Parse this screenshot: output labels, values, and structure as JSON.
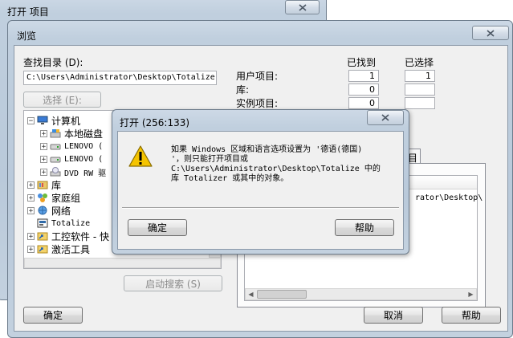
{
  "outer_window": {
    "title": "打开 项目"
  },
  "browse_dialog": {
    "title": "浏览",
    "lookin_label": "查找目录 (D):",
    "path_value": "C:\\Users\\Administrator\\Desktop\\Totalize",
    "select_button": "选择 (E):",
    "found_header": "已找到",
    "selected_header": "已选择",
    "stats": [
      {
        "label": "用户项目:",
        "found": "1",
        "selected": "1"
      },
      {
        "label": "库:",
        "found": "0",
        "selected": ""
      },
      {
        "label": "实例项目:",
        "found": "0",
        "selected": ""
      }
    ],
    "tree": [
      {
        "label": "计算机",
        "icon": "computer-icon",
        "expander": "−",
        "indent": 0
      },
      {
        "label": "本地磁盘",
        "icon": "local-disk-icon",
        "expander": "+",
        "indent": 1
      },
      {
        "label": "LENOVO (",
        "icon": "drive-icon",
        "expander": "+",
        "indent": 1
      },
      {
        "label": "LENOVO (",
        "icon": "drive-icon",
        "expander": "+",
        "indent": 1
      },
      {
        "label": "DVD RW 驱",
        "icon": "dvd-drive-icon",
        "expander": "+",
        "indent": 1
      },
      {
        "label": "库",
        "icon": "library-icon",
        "expander": "+",
        "indent": 0
      },
      {
        "label": "家庭组",
        "icon": "homegroup-icon",
        "expander": "+",
        "indent": 0
      },
      {
        "label": "网络",
        "icon": "network-icon",
        "expander": "+",
        "indent": 0
      },
      {
        "label": "Totalize",
        "icon": "project-icon",
        "expander": "",
        "indent": 0
      },
      {
        "label": "工控软件 - 快",
        "icon": "shortcut-folder-icon",
        "expander": "+",
        "indent": 0
      },
      {
        "label": "激活工具",
        "icon": "shortcut-folder-icon",
        "expander": "+",
        "indent": 0
      }
    ],
    "tab_label": "目",
    "list_path_fragment": "rator\\Desktop\\",
    "start_search_button": "启动搜索 (S)",
    "ok_button": "确定",
    "cancel_button": "取消",
    "help_button": "帮助"
  },
  "message_box": {
    "title": "打开 (256:133)",
    "message_lines": [
      "如果 Windows 区域和语言选项设置为 '德语(德国)",
      "'，则只能打开项目或",
      "C:\\Users\\Administrator\\Desktop\\Totalize 中的",
      "库 Totalizer 或其中的对象。"
    ],
    "ok_button": "确定",
    "help_button": "帮助"
  },
  "colors": {
    "title_bar": "#c0cfde",
    "client_bg": "#f0f0f0",
    "warning_yellow": "#f5c400"
  }
}
